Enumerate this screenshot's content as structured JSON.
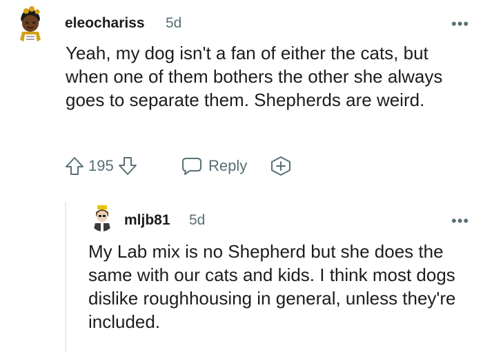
{
  "comment": {
    "username": "eleochariss",
    "age": "5d",
    "more": "•••",
    "text": "Yeah, my dog isn't a fan of either the cats, but when one of them bothers the other she always goes to separate them. Shepherds are weird.",
    "score": "195",
    "reply_label": "Reply"
  },
  "reply": {
    "username": "mljb81",
    "age": "5d",
    "more": "•••",
    "text": "My Lab mix is no Shepherd but she does the same with our cats and kids. I think most dogs dislike roughhousing in general, unless they're included."
  },
  "colors": {
    "meta": "#576f76",
    "text": "#1c1c1c",
    "thread": "#e5ebee"
  },
  "icons": [
    "upvote-icon",
    "downvote-icon",
    "reply-icon",
    "award-icon",
    "more-icon"
  ]
}
